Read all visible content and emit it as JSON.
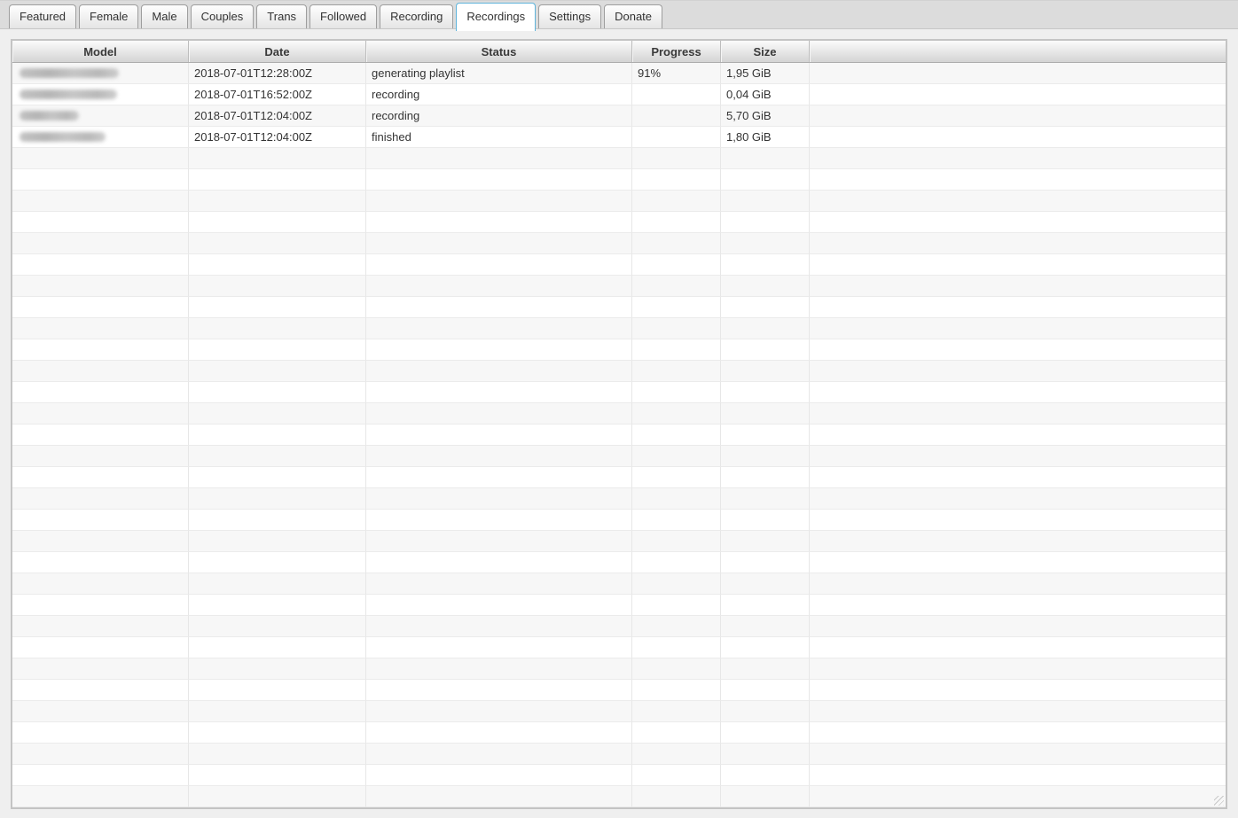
{
  "tabs": {
    "items": [
      {
        "label": "Featured",
        "active": false
      },
      {
        "label": "Female",
        "active": false
      },
      {
        "label": "Male",
        "active": false
      },
      {
        "label": "Couples",
        "active": false
      },
      {
        "label": "Trans",
        "active": false
      },
      {
        "label": "Followed",
        "active": false
      },
      {
        "label": "Recording",
        "active": false
      },
      {
        "label": "Recordings",
        "active": true
      },
      {
        "label": "Settings",
        "active": false
      },
      {
        "label": "Donate",
        "active": false
      }
    ]
  },
  "table": {
    "columns": [
      {
        "label": "Model"
      },
      {
        "label": "Date"
      },
      {
        "label": "Status"
      },
      {
        "label": "Progress"
      },
      {
        "label": "Size"
      },
      {
        "label": ""
      }
    ],
    "rows": [
      {
        "model": "",
        "model_redacted": true,
        "model_blur_width": 112,
        "date": "2018-07-01T12:28:00Z",
        "status": "generating playlist",
        "progress": "91%",
        "size": "1,95 GiB"
      },
      {
        "model": "",
        "model_redacted": true,
        "model_blur_width": 110,
        "date": "2018-07-01T16:52:00Z",
        "status": "recording",
        "progress": "",
        "size": "0,04 GiB"
      },
      {
        "model": "",
        "model_redacted": true,
        "model_blur_width": 67,
        "date": "2018-07-01T12:04:00Z",
        "status": "recording",
        "progress": "",
        "size": "5,70 GiB"
      },
      {
        "model": "",
        "model_redacted": true,
        "model_blur_width": 97,
        "date": "2018-07-01T12:04:00Z",
        "status": "finished",
        "progress": "",
        "size": "1,80 GiB"
      }
    ],
    "empty_row_count": 31
  },
  "colors": {
    "active_tab_border": "#5eb3da",
    "tab_strip_bg": "#dcdcdc",
    "page_bg": "#efefef",
    "table_border": "#c4c4c4",
    "header_gradient_top": "#fbfbfb",
    "header_gradient_bottom": "#d4d4d4",
    "row_stripe": "#f7f7f7",
    "text": "#333333"
  }
}
